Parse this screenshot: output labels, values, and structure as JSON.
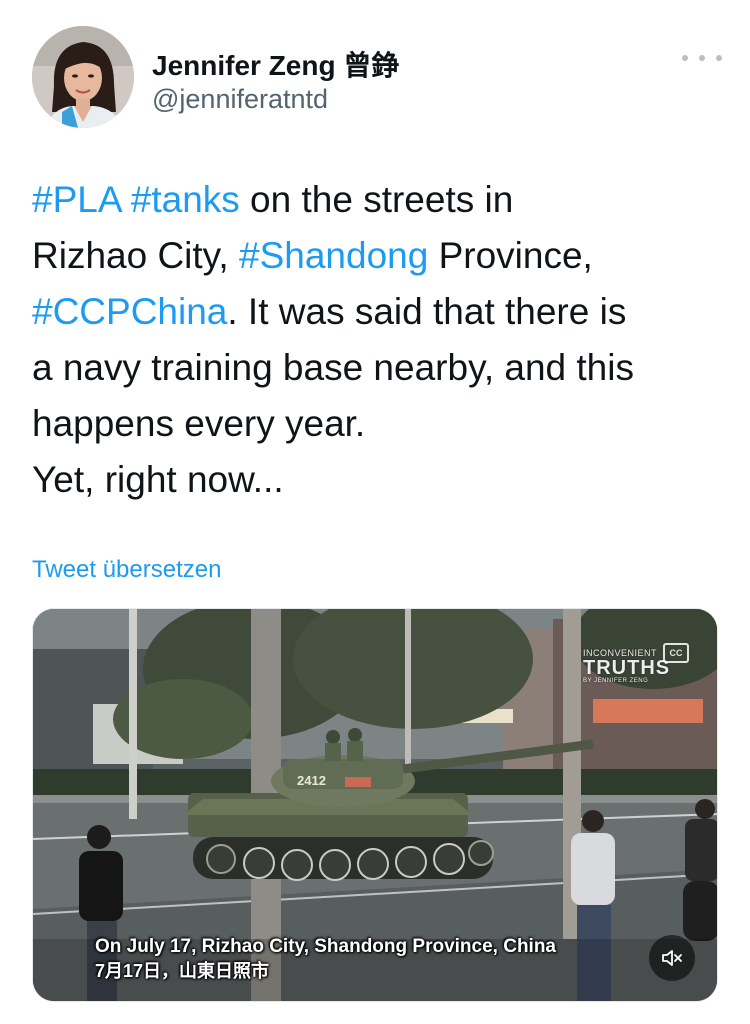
{
  "author": {
    "name": "Jennifer Zeng 曾錚",
    "handle": "@jenniferatntd"
  },
  "tweet": {
    "line1_tag1": "#PLA",
    "line1_tag2": "#tanks",
    "line1_text": " on the streets in",
    "line2_text": "Rizhao City, ",
    "line2_tag": "#Shandong",
    "line2_text2": " Province,",
    "line3_tag": "#CCPChina",
    "line3_text": ". It was said that there is",
    "line4_text": "a navy training base nearby, and this",
    "line5_text": "happens every year.",
    "line6_text": "Yet, right now..."
  },
  "translate_label": "Tweet übersetzen",
  "media": {
    "caption_en": "On July 17, Rizhao City, Shandong Province, China",
    "caption_cn": "7月17日，山東日照市",
    "tank_number": "2412",
    "watermark_top": "INCONVENIENT",
    "watermark_main": "TRUTHS",
    "watermark_sub": "BY JENNIFER ZENG",
    "cc_label": "CC"
  },
  "icons": {
    "more": "more-dots-icon",
    "mute": "speaker-muted-icon",
    "cc": "closed-captions-icon"
  },
  "colors": {
    "link": "#1d9bf0",
    "text": "#0f1419",
    "secondary": "#536471"
  }
}
